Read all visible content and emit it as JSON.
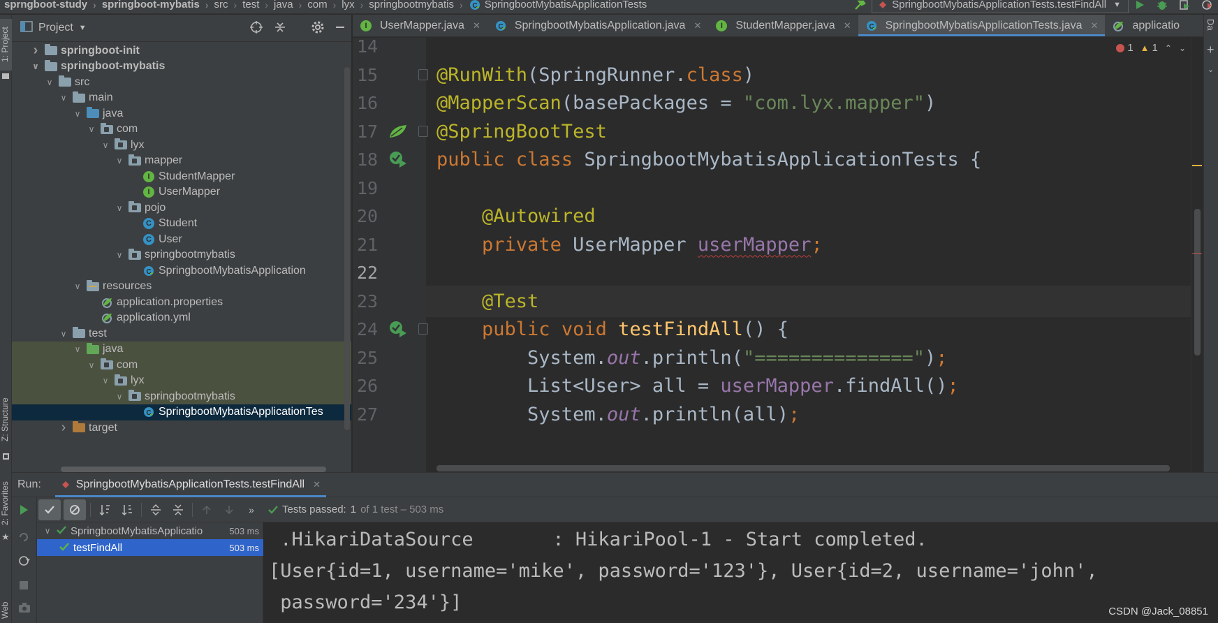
{
  "breadcrumb": [
    "sprngboot-study",
    "springboot-mybatis",
    "src",
    "test",
    "java",
    "com",
    "lyx",
    "springbootmybatis",
    "SpringbootMybatisApplicationTests"
  ],
  "run_config": "SpringbootMybatisApplicationTests.testFindAll",
  "project_panel": {
    "title": "Project",
    "left_strip_labels": {
      "project": "1: Project",
      "structure": "Z: Structure",
      "favorites": "2: Favorites",
      "web": "Web"
    },
    "tree": [
      {
        "label": "springboot-init",
        "depth": 0,
        "arrow": "right",
        "icon": "module-folder",
        "bold": true
      },
      {
        "label": "springboot-mybatis",
        "depth": 0,
        "arrow": "down",
        "icon": "module-folder",
        "bold": true
      },
      {
        "label": "src",
        "depth": 1,
        "arrow": "down",
        "icon": "folder"
      },
      {
        "label": "main",
        "depth": 2,
        "arrow": "down",
        "icon": "folder"
      },
      {
        "label": "java",
        "depth": 3,
        "arrow": "down",
        "icon": "source-folder"
      },
      {
        "label": "com",
        "depth": 4,
        "arrow": "down",
        "icon": "package"
      },
      {
        "label": "lyx",
        "depth": 5,
        "arrow": "down",
        "icon": "package"
      },
      {
        "label": "mapper",
        "depth": 6,
        "arrow": "down",
        "icon": "package"
      },
      {
        "label": "StudentMapper",
        "depth": 7,
        "arrow": "",
        "icon": "interface"
      },
      {
        "label": "UserMapper",
        "depth": 7,
        "arrow": "",
        "icon": "interface"
      },
      {
        "label": "pojo",
        "depth": 6,
        "arrow": "down",
        "icon": "package"
      },
      {
        "label": "Student",
        "depth": 7,
        "arrow": "",
        "icon": "class"
      },
      {
        "label": "User",
        "depth": 7,
        "arrow": "",
        "icon": "class"
      },
      {
        "label": "springbootmybatis",
        "depth": 6,
        "arrow": "down",
        "icon": "package"
      },
      {
        "label": "SpringbootMybatisApplication",
        "depth": 7,
        "arrow": "",
        "icon": "spring-class"
      },
      {
        "label": "resources",
        "depth": 3,
        "arrow": "down",
        "icon": "resources-folder"
      },
      {
        "label": "application.properties",
        "depth": 4,
        "arrow": "",
        "icon": "spring-config"
      },
      {
        "label": "application.yml",
        "depth": 4,
        "arrow": "",
        "icon": "spring-config"
      },
      {
        "label": "test",
        "depth": 2,
        "arrow": "down",
        "icon": "folder"
      },
      {
        "label": "java",
        "depth": 3,
        "arrow": "down",
        "icon": "test-folder",
        "highlight": true
      },
      {
        "label": "com",
        "depth": 4,
        "arrow": "down",
        "icon": "package",
        "highlight": true
      },
      {
        "label": "lyx",
        "depth": 5,
        "arrow": "down",
        "icon": "package",
        "highlight": true
      },
      {
        "label": "springbootmybatis",
        "depth": 6,
        "arrow": "down",
        "icon": "package",
        "highlight": true
      },
      {
        "label": "SpringbootMybatisApplicationTes",
        "depth": 7,
        "arrow": "",
        "icon": "spring-class",
        "selected": true
      },
      {
        "label": "target",
        "depth": 2,
        "arrow": "right",
        "icon": "excluded-folder"
      }
    ]
  },
  "editor_tabs": [
    {
      "label": "UserMapper.java",
      "icon": "interface"
    },
    {
      "label": "SpringbootMybatisApplication.java",
      "icon": "spring-class"
    },
    {
      "label": "StudentMapper.java",
      "icon": "interface"
    },
    {
      "label": "SpringbootMybatisApplicationTests.java",
      "icon": "spring-class",
      "active": true
    },
    {
      "label": "applicatio",
      "icon": "spring-config"
    }
  ],
  "inspections": {
    "errors": "1",
    "warnings": "1"
  },
  "code_lines": [
    {
      "num": "14",
      "html": ""
    },
    {
      "num": "15",
      "html": "<span class=\"ann\">@RunWith</span>(SpringRunner.<span class=\"kw\">class</span>)"
    },
    {
      "num": "16",
      "html": "<span class=\"ann\">@MapperScan</span>(basePackages = <span class=\"str\">\"com.lyx.mapper\"</span>)"
    },
    {
      "num": "17",
      "html": "<span class=\"ann\">@SpringBootTest</span>"
    },
    {
      "num": "18",
      "html": "<span class=\"kw\">public class </span>SpringbootMybatisApplicationTests {"
    },
    {
      "num": "19",
      "html": ""
    },
    {
      "num": "20",
      "html": "    <span class=\"ann\">@Autowired</span>"
    },
    {
      "num": "21",
      "html": "    <span class=\"kw\">private </span>UserMapper <span class=\"field warn\">userMapper</span><span class=\"kw\">;</span>"
    },
    {
      "num": "22",
      "html": ""
    },
    {
      "num": "23",
      "html": "    <span class=\"ann\">@Test</span>"
    },
    {
      "num": "24",
      "html": "    <span class=\"kw\">public void </span><span class=\"fn\">testFindAll</span>() {"
    },
    {
      "num": "25",
      "html": "        System.<span class=\"ital\">out</span>.println(<span class=\"str\">\"==============\"</span>)<span class=\"kw\">;</span>"
    },
    {
      "num": "26",
      "html": "        List&lt;User&gt; all = <span class=\"field\">userMapper</span>.findAll()<span class=\"kw\">;</span>"
    },
    {
      "num": "27",
      "html": "        System.<span class=\"ital\">out</span>.println(all)<span class=\"kw\">;</span>"
    }
  ],
  "run_panel": {
    "label": "Run:",
    "tab": "SpringbootMybatisApplicationTests.testFindAll",
    "status": {
      "prefix": "Tests passed:",
      "count": "1",
      "suffix": "of 1 test – 503 ms"
    },
    "tests": [
      {
        "label": "SpringbootMybatisApplicatio",
        "time": "503 ms",
        "depth": 0
      },
      {
        "label": "testFindAll",
        "time": "503 ms",
        "depth": 1,
        "selected": true
      }
    ],
    "console": [
      " .HikariDataSource       : HikariPool-1 - Start completed.",
      "[User{id=1, username='mike', password='123'}, User{id=2, username='john',",
      " password='234'}]"
    ]
  },
  "watermark": "CSDN @Jack_08851",
  "colors": {
    "accent": "#4a88c7",
    "pass": "#499c54",
    "selection": "#2f65ca"
  }
}
